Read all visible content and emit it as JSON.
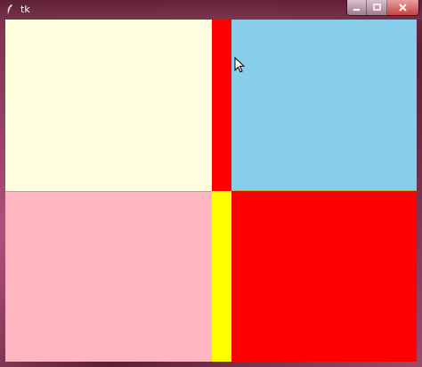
{
  "window": {
    "title": "tk",
    "icon": "feather-icon",
    "controls": {
      "minimize": "minimize-icon",
      "maximize": "maximize-icon",
      "close": "close-icon"
    }
  },
  "panels": [
    {
      "name": "top-left-panel",
      "color": "#ffffe0"
    },
    {
      "name": "top-divider",
      "color": "#ff0000"
    },
    {
      "name": "top-right-panel",
      "color": "#87ceeb"
    },
    {
      "name": "bottom-left-panel",
      "color": "#ffb6c1"
    },
    {
      "name": "bottom-divider",
      "color": "#ffff00"
    },
    {
      "name": "bottom-right-panel",
      "color": "#ff0000"
    }
  ]
}
